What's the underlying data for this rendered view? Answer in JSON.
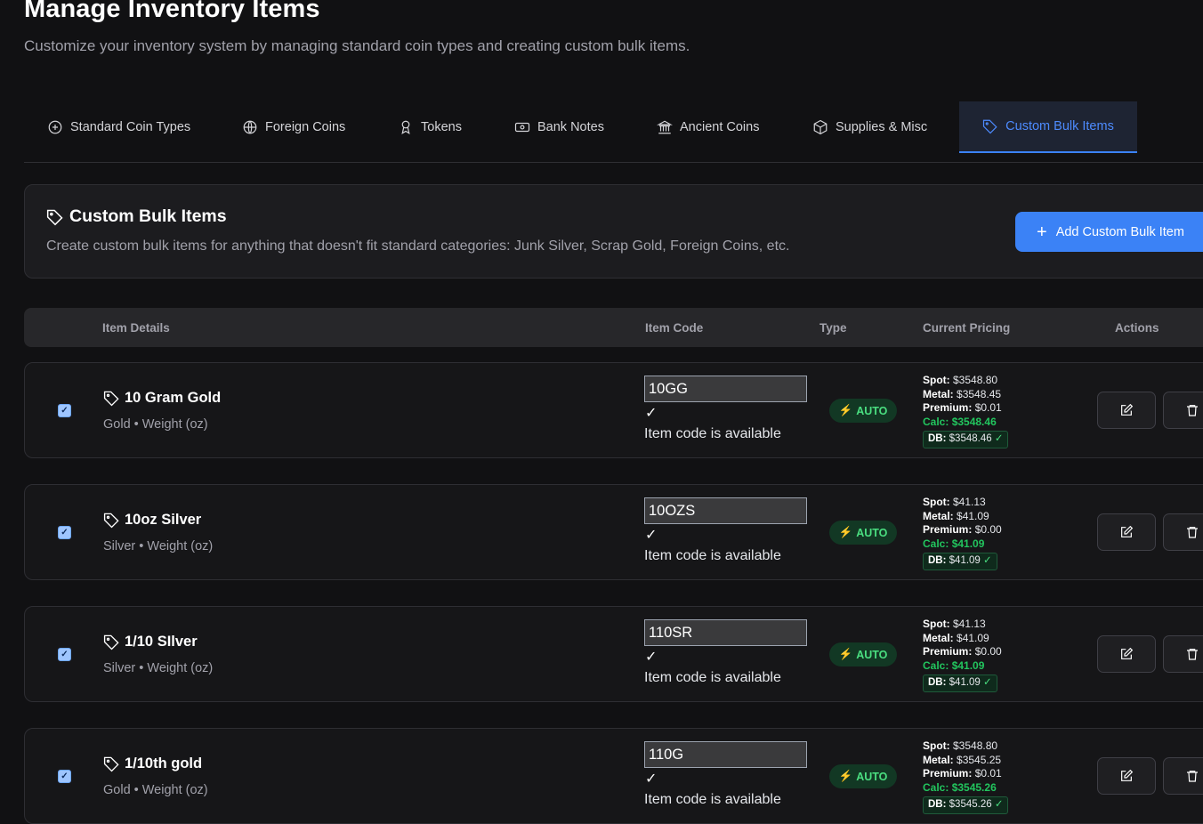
{
  "header": {
    "title": "Manage Inventory Items",
    "subtitle": "Customize your inventory system by managing standard coin types and creating custom bulk items."
  },
  "tabs": [
    {
      "label": "Standard Coin Types",
      "icon": "plus-circle-icon"
    },
    {
      "label": "Foreign Coins",
      "icon": "globe-icon"
    },
    {
      "label": "Tokens",
      "icon": "award-icon"
    },
    {
      "label": "Bank Notes",
      "icon": "banknote-icon"
    },
    {
      "label": "Ancient Coins",
      "icon": "landmark-icon"
    },
    {
      "label": "Supplies & Misc",
      "icon": "package-icon"
    },
    {
      "label": "Custom Bulk Items",
      "icon": "tag-icon",
      "active": true
    }
  ],
  "panel": {
    "title": "Custom Bulk Items",
    "description": "Create custom bulk items for anything that doesn't fit standard categories: Junk Silver, Scrap Gold, Foreign Coins, etc.",
    "add_button_label": "Add Custom Bulk Item"
  },
  "table": {
    "headers": {
      "details": "Item Details",
      "code": "Item Code",
      "type": "Type",
      "pricing": "Current Pricing",
      "actions": "Actions"
    },
    "rows": [
      {
        "name": "10 Gram Gold",
        "meta": "Gold • Weight (oz)",
        "code": "10GG",
        "check": "✓",
        "status": "Item code is available",
        "type": "AUTO",
        "spot": "$3548.80",
        "metal": "$3548.45",
        "premium": "$0.01",
        "calc": "$3548.46",
        "db": "$3548.46",
        "checked": true
      },
      {
        "name": "10oz Silver",
        "meta": "Silver • Weight (oz)",
        "code": "10OZS",
        "check": "✓",
        "status": "Item code is available",
        "type": "AUTO",
        "spot": "$41.13",
        "metal": "$41.09",
        "premium": "$0.00",
        "calc": "$41.09",
        "db": "$41.09",
        "checked": true
      },
      {
        "name": "1/10 SIlver",
        "meta": "Silver • Weight (oz)",
        "code": "110SR",
        "check": "✓",
        "status": "Item code is available",
        "type": "AUTO",
        "spot": "$41.13",
        "metal": "$41.09",
        "premium": "$0.00",
        "calc": "$41.09",
        "db": "$41.09",
        "checked": true
      },
      {
        "name": "1/10th gold",
        "meta": "Gold • Weight (oz)",
        "code": "110G",
        "check": "✓",
        "status": "Item code is available",
        "type": "AUTO",
        "spot": "$3548.80",
        "metal": "$3545.25",
        "premium": "$0.01",
        "calc": "$3545.26",
        "db": "$3545.26",
        "checked": true
      }
    ],
    "labels": {
      "spot": "Spot:",
      "metal": "Metal:",
      "premium": "Premium:",
      "calc": "Calc:",
      "db": "DB:"
    }
  },
  "colors": {
    "accent": "#3b82f6",
    "success": "#22c55e",
    "background": "#111113"
  }
}
